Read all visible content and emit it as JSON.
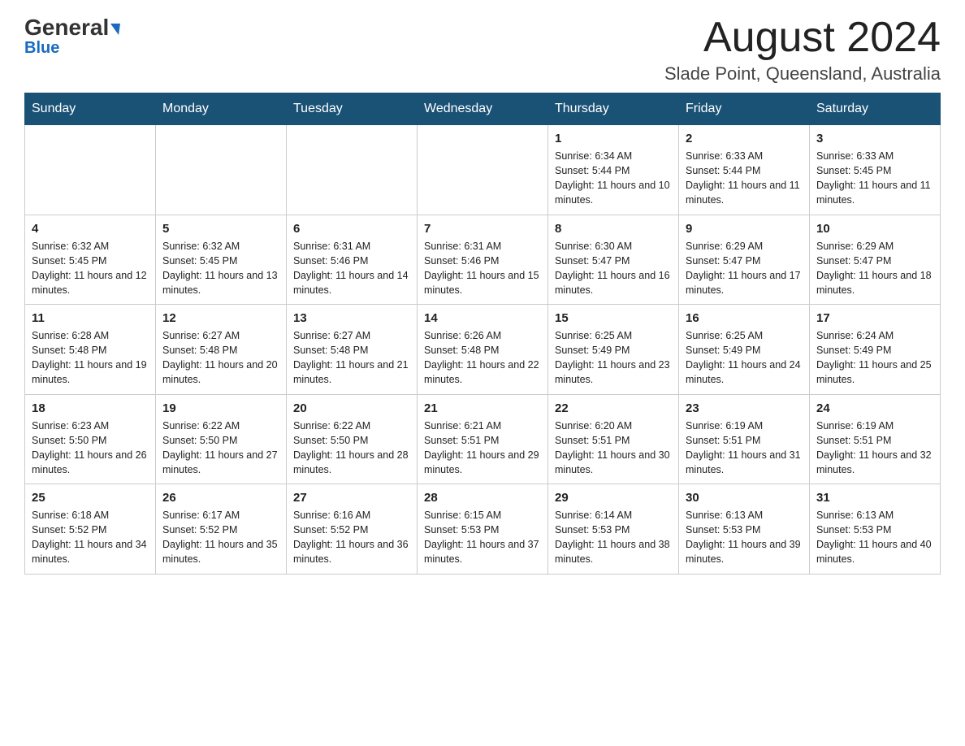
{
  "logo": {
    "text_general": "General",
    "text_blue": "Blue"
  },
  "header": {
    "month": "August 2024",
    "location": "Slade Point, Queensland, Australia"
  },
  "days_of_week": [
    "Sunday",
    "Monday",
    "Tuesday",
    "Wednesday",
    "Thursday",
    "Friday",
    "Saturday"
  ],
  "weeks": [
    [
      {
        "day": "",
        "info": ""
      },
      {
        "day": "",
        "info": ""
      },
      {
        "day": "",
        "info": ""
      },
      {
        "day": "",
        "info": ""
      },
      {
        "day": "1",
        "info": "Sunrise: 6:34 AM\nSunset: 5:44 PM\nDaylight: 11 hours and 10 minutes."
      },
      {
        "day": "2",
        "info": "Sunrise: 6:33 AM\nSunset: 5:44 PM\nDaylight: 11 hours and 11 minutes."
      },
      {
        "day": "3",
        "info": "Sunrise: 6:33 AM\nSunset: 5:45 PM\nDaylight: 11 hours and 11 minutes."
      }
    ],
    [
      {
        "day": "4",
        "info": "Sunrise: 6:32 AM\nSunset: 5:45 PM\nDaylight: 11 hours and 12 minutes."
      },
      {
        "day": "5",
        "info": "Sunrise: 6:32 AM\nSunset: 5:45 PM\nDaylight: 11 hours and 13 minutes."
      },
      {
        "day": "6",
        "info": "Sunrise: 6:31 AM\nSunset: 5:46 PM\nDaylight: 11 hours and 14 minutes."
      },
      {
        "day": "7",
        "info": "Sunrise: 6:31 AM\nSunset: 5:46 PM\nDaylight: 11 hours and 15 minutes."
      },
      {
        "day": "8",
        "info": "Sunrise: 6:30 AM\nSunset: 5:47 PM\nDaylight: 11 hours and 16 minutes."
      },
      {
        "day": "9",
        "info": "Sunrise: 6:29 AM\nSunset: 5:47 PM\nDaylight: 11 hours and 17 minutes."
      },
      {
        "day": "10",
        "info": "Sunrise: 6:29 AM\nSunset: 5:47 PM\nDaylight: 11 hours and 18 minutes."
      }
    ],
    [
      {
        "day": "11",
        "info": "Sunrise: 6:28 AM\nSunset: 5:48 PM\nDaylight: 11 hours and 19 minutes."
      },
      {
        "day": "12",
        "info": "Sunrise: 6:27 AM\nSunset: 5:48 PM\nDaylight: 11 hours and 20 minutes."
      },
      {
        "day": "13",
        "info": "Sunrise: 6:27 AM\nSunset: 5:48 PM\nDaylight: 11 hours and 21 minutes."
      },
      {
        "day": "14",
        "info": "Sunrise: 6:26 AM\nSunset: 5:48 PM\nDaylight: 11 hours and 22 minutes."
      },
      {
        "day": "15",
        "info": "Sunrise: 6:25 AM\nSunset: 5:49 PM\nDaylight: 11 hours and 23 minutes."
      },
      {
        "day": "16",
        "info": "Sunrise: 6:25 AM\nSunset: 5:49 PM\nDaylight: 11 hours and 24 minutes."
      },
      {
        "day": "17",
        "info": "Sunrise: 6:24 AM\nSunset: 5:49 PM\nDaylight: 11 hours and 25 minutes."
      }
    ],
    [
      {
        "day": "18",
        "info": "Sunrise: 6:23 AM\nSunset: 5:50 PM\nDaylight: 11 hours and 26 minutes."
      },
      {
        "day": "19",
        "info": "Sunrise: 6:22 AM\nSunset: 5:50 PM\nDaylight: 11 hours and 27 minutes."
      },
      {
        "day": "20",
        "info": "Sunrise: 6:22 AM\nSunset: 5:50 PM\nDaylight: 11 hours and 28 minutes."
      },
      {
        "day": "21",
        "info": "Sunrise: 6:21 AM\nSunset: 5:51 PM\nDaylight: 11 hours and 29 minutes."
      },
      {
        "day": "22",
        "info": "Sunrise: 6:20 AM\nSunset: 5:51 PM\nDaylight: 11 hours and 30 minutes."
      },
      {
        "day": "23",
        "info": "Sunrise: 6:19 AM\nSunset: 5:51 PM\nDaylight: 11 hours and 31 minutes."
      },
      {
        "day": "24",
        "info": "Sunrise: 6:19 AM\nSunset: 5:51 PM\nDaylight: 11 hours and 32 minutes."
      }
    ],
    [
      {
        "day": "25",
        "info": "Sunrise: 6:18 AM\nSunset: 5:52 PM\nDaylight: 11 hours and 34 minutes."
      },
      {
        "day": "26",
        "info": "Sunrise: 6:17 AM\nSunset: 5:52 PM\nDaylight: 11 hours and 35 minutes."
      },
      {
        "day": "27",
        "info": "Sunrise: 6:16 AM\nSunset: 5:52 PM\nDaylight: 11 hours and 36 minutes."
      },
      {
        "day": "28",
        "info": "Sunrise: 6:15 AM\nSunset: 5:53 PM\nDaylight: 11 hours and 37 minutes."
      },
      {
        "day": "29",
        "info": "Sunrise: 6:14 AM\nSunset: 5:53 PM\nDaylight: 11 hours and 38 minutes."
      },
      {
        "day": "30",
        "info": "Sunrise: 6:13 AM\nSunset: 5:53 PM\nDaylight: 11 hours and 39 minutes."
      },
      {
        "day": "31",
        "info": "Sunrise: 6:13 AM\nSunset: 5:53 PM\nDaylight: 11 hours and 40 minutes."
      }
    ]
  ]
}
